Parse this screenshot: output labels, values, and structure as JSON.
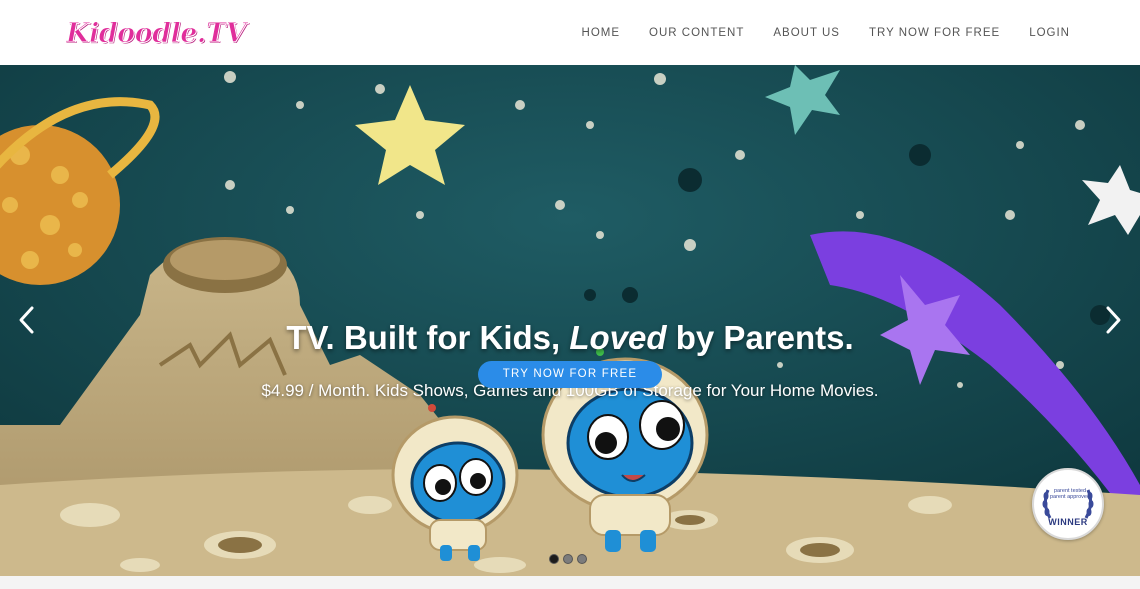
{
  "header": {
    "logo_text": "Kidoodle.TV",
    "nav": [
      {
        "label": "HOME"
      },
      {
        "label": "OUR CONTENT"
      },
      {
        "label": "ABOUT US"
      },
      {
        "label": "TRY NOW FOR FREE"
      },
      {
        "label": "LOGIN"
      }
    ]
  },
  "hero": {
    "title_part1": "TV. Built for Kids, ",
    "title_emphasis": "Loved",
    "title_part2": " by Parents.",
    "subtitle": "$4.99 / Month. Kids Shows, Games and 100GB of Storage for Your Home Movies.",
    "cta_label": "TRY NOW FOR FREE",
    "slides_total": 3,
    "active_slide": 1
  },
  "badge": {
    "top_text": "parent tested parent approved",
    "bottom_text": "WINNER"
  },
  "colors": {
    "brand_pink": "#e02e9b",
    "cta_blue": "#2b8ce8",
    "nav_text": "#555555"
  },
  "icons": [
    "chevron-left-icon",
    "chevron-right-icon",
    "laurel-icon"
  ]
}
